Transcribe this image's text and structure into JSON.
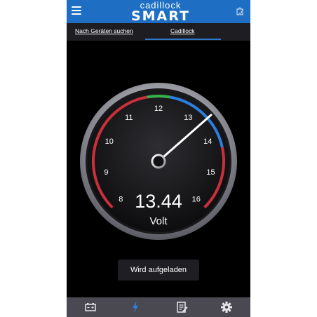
{
  "app": {
    "title_line1": "cadillock",
    "title_line2": "SMART"
  },
  "header": {
    "menu_icon": "hamburger-menu-icon",
    "settings_icon": "puzzle-settings-icon"
  },
  "tabs": [
    {
      "label": "Nach Geräten suchen",
      "active": false
    },
    {
      "label": "Cadillock",
      "active": true
    }
  ],
  "gauge": {
    "value": "13.44",
    "value_number": 13.44,
    "unit": "Volt",
    "scale_min": 8,
    "scale_max": 16,
    "ticks": [
      "8",
      "9",
      "10",
      "11",
      "12",
      "13",
      "14",
      "15",
      "16"
    ],
    "colors": {
      "red": "#c9303a",
      "green": "#38b24a",
      "blue": "#2a7fe0",
      "needle": "#ffffff"
    }
  },
  "status": {
    "label": "Wird aufgeladen"
  },
  "bottom_nav": [
    {
      "icon": "battery-icon",
      "active": false
    },
    {
      "icon": "lightning-icon",
      "active": true
    },
    {
      "icon": "notes-edit-icon",
      "active": false
    },
    {
      "icon": "gear-icon",
      "active": false
    }
  ]
}
